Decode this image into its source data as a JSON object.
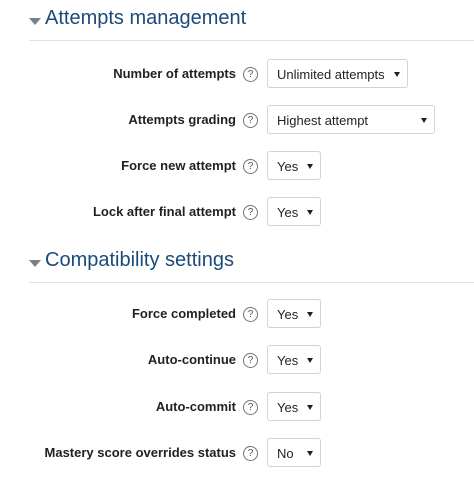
{
  "sections": [
    {
      "title": "Attempts management",
      "fields": [
        {
          "label": "Number of attempts",
          "value": "Unlimited attempts",
          "help": "?"
        },
        {
          "label": "Attempts grading",
          "value": "Highest attempt",
          "help": "?"
        },
        {
          "label": "Force new attempt",
          "value": "Yes",
          "help": "?"
        },
        {
          "label": "Lock after final attempt",
          "value": "Yes",
          "help": "?"
        }
      ]
    },
    {
      "title": "Compatibility settings",
      "fields": [
        {
          "label": "Force completed",
          "value": "Yes",
          "help": "?"
        },
        {
          "label": "Auto-continue",
          "value": "Yes",
          "help": "?"
        },
        {
          "label": "Auto-commit",
          "value": "Yes",
          "help": "?"
        },
        {
          "label": "Mastery score overrides status",
          "value": "No",
          "help": "?"
        }
      ]
    }
  ]
}
